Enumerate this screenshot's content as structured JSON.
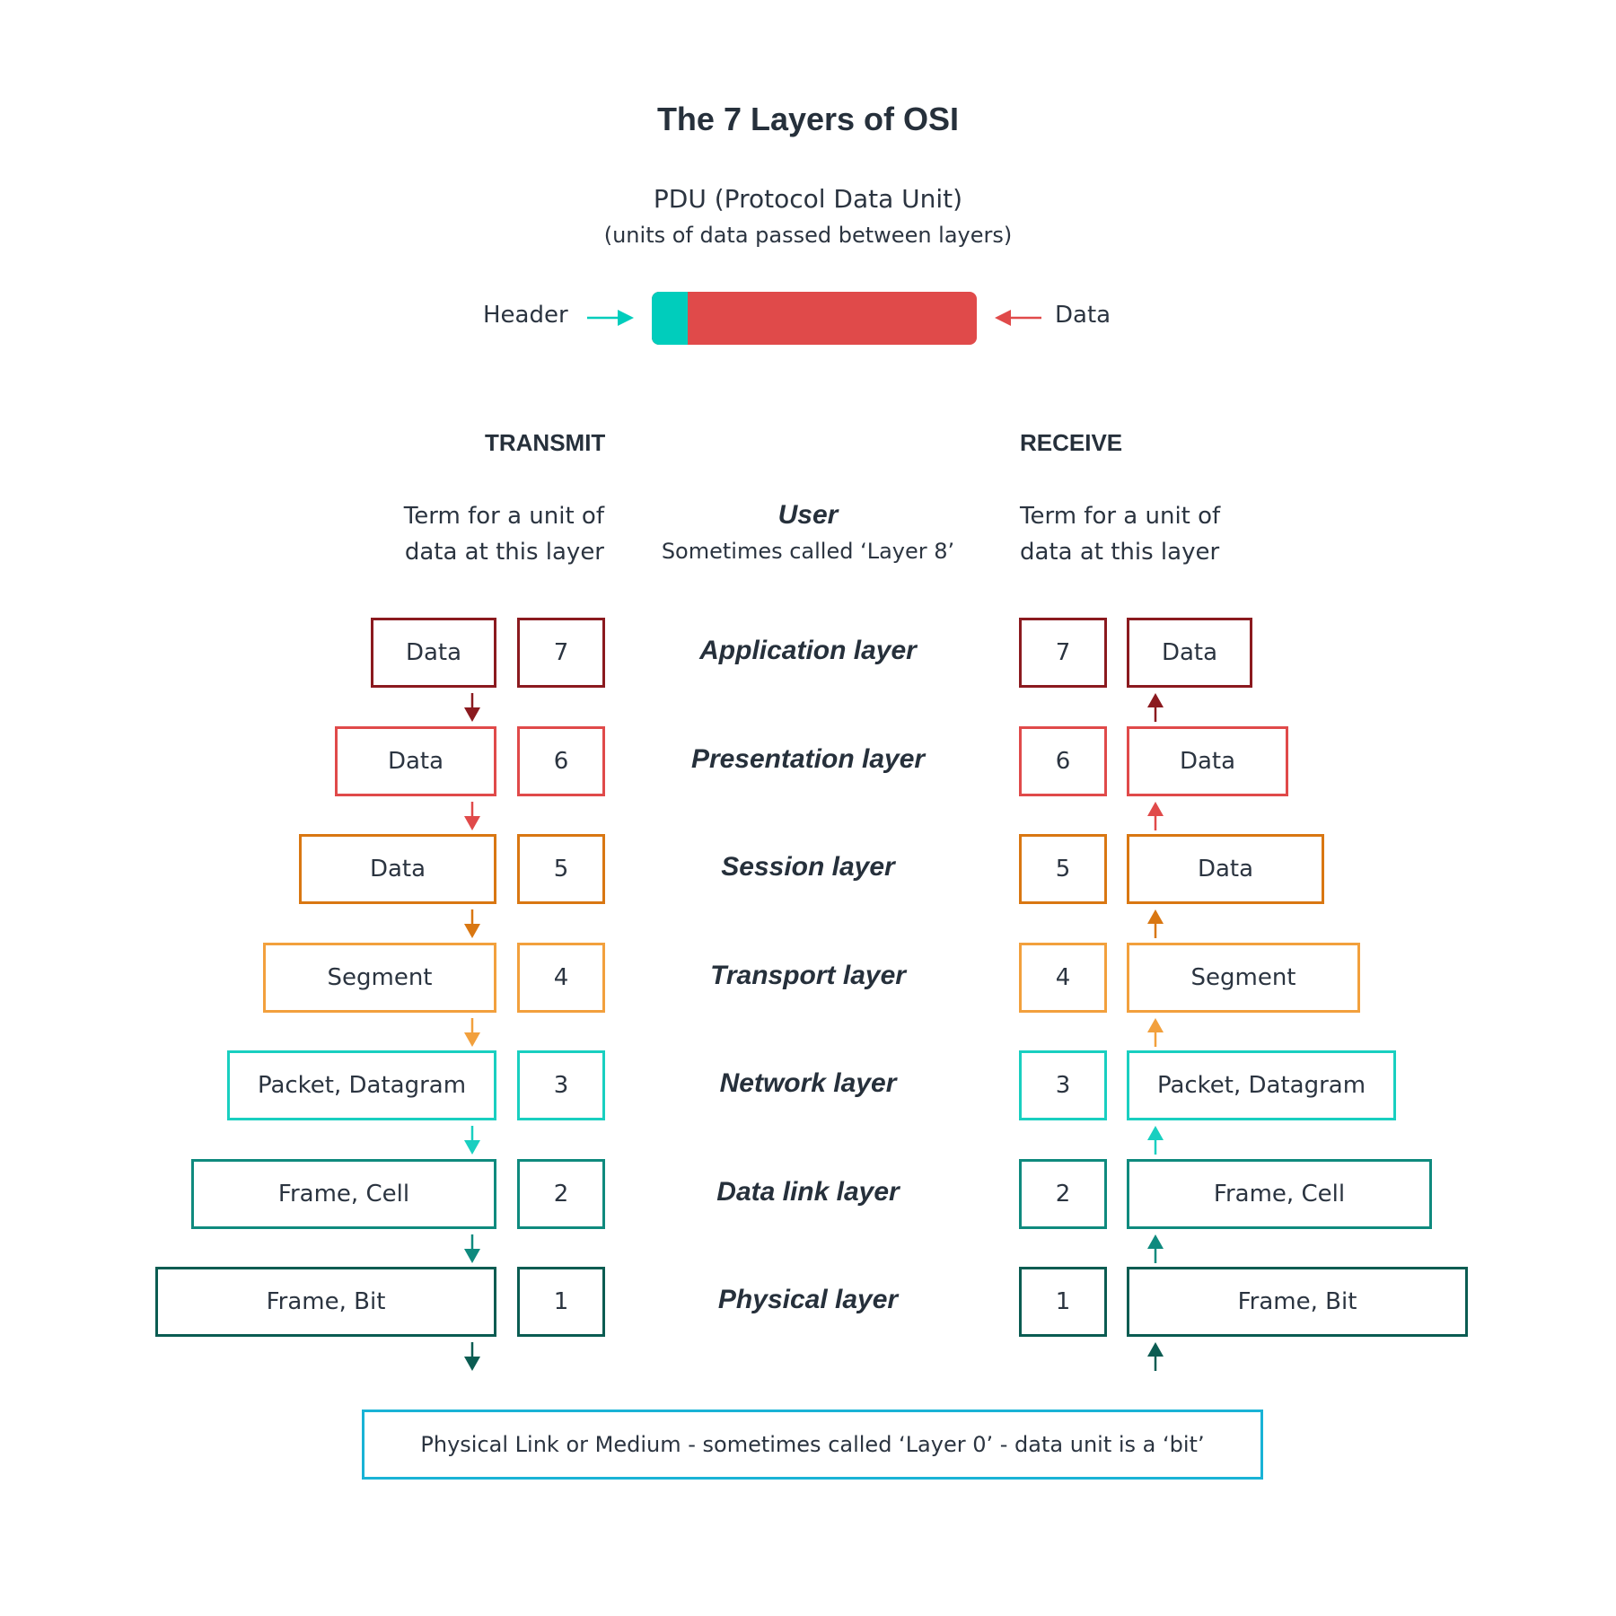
{
  "title": "The 7 Layers of OSI",
  "pdu": {
    "heading": "PDU (Protocol Data Unit)",
    "subheading": "(units of data passed between layers)",
    "header_label": "Header",
    "data_label": "Data",
    "header_color": "#00cdbc",
    "data_color": "#e04a4a"
  },
  "columns": {
    "transmit": "TRANSMIT",
    "receive": "RECEIVE",
    "transmit_term_line1": "Term for a unit of",
    "transmit_term_line2": "data at this layer",
    "receive_term_line1": "Term for a unit of",
    "receive_term_line2": "data at this layer"
  },
  "user": {
    "label": "User",
    "sublabel": "Sometimes called ‘Layer 8’"
  },
  "layers": [
    {
      "number": "7",
      "name": "Application layer",
      "unit": "Data",
      "color": "#8b1a1f"
    },
    {
      "number": "6",
      "name": "Presentation layer",
      "unit": "Data",
      "color": "#e04a4a"
    },
    {
      "number": "5",
      "name": "Session layer",
      "unit": "Data",
      "color": "#d97712"
    },
    {
      "number": "4",
      "name": "Transport layer",
      "unit": "Segment",
      "color": "#f2a03d"
    },
    {
      "number": "3",
      "name": "Network layer",
      "unit": "Packet, Datagram",
      "color": "#19cfc0"
    },
    {
      "number": "2",
      "name": "Data link layer",
      "unit": "Frame, Cell",
      "color": "#0f8a7e"
    },
    {
      "number": "1",
      "name": "Physical layer",
      "unit": "Frame, Bit",
      "color": "#0b5c52"
    }
  ],
  "medium": {
    "text": "Physical Link or Medium - sometimes called ‘Layer 0’ - data unit is a ‘bit’",
    "color": "#19b3d6"
  }
}
